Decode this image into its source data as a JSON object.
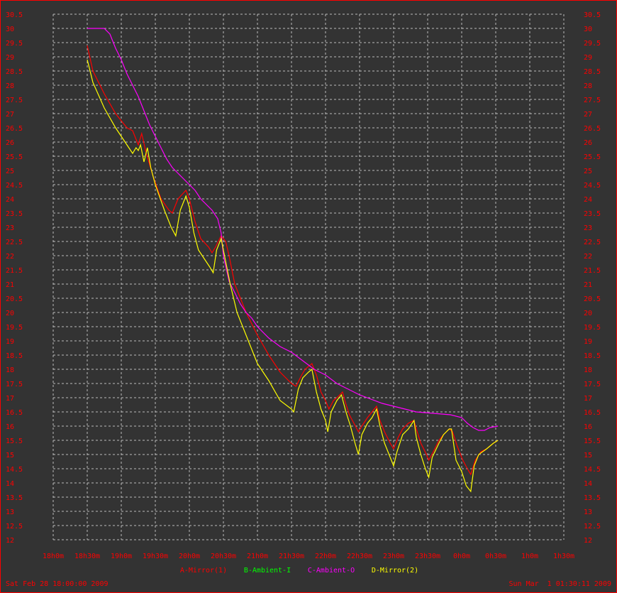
{
  "chart_data": {
    "type": "line",
    "title": "",
    "xlabel": "",
    "ylabel": "",
    "ylim": [
      12,
      30.5
    ],
    "yticks": [
      "12",
      "12.5",
      "13",
      "13.5",
      "14",
      "14.5",
      "15",
      "15.5",
      "16",
      "16.5",
      "17",
      "17.5",
      "18",
      "18.5",
      "19",
      "19.5",
      "20",
      "20.5",
      "21",
      "21.5",
      "22",
      "22.5",
      "23",
      "23.5",
      "24",
      "24.5",
      "25",
      "25.5",
      "26",
      "26.5",
      "27",
      "27.5",
      "28",
      "28.5",
      "29",
      "29.5",
      "30",
      "30.5"
    ],
    "xticks": [
      "18h0m",
      "18h30m",
      "19h0m",
      "19h30m",
      "20h0m",
      "20h30m",
      "21h0m",
      "21h30m",
      "22h0m",
      "22h30m",
      "23h0m",
      "23h30m",
      "0h0m",
      "0h30m",
      "1h0m",
      "1h30m"
    ],
    "x_unit": "minutes since 18h0m",
    "grid": true,
    "legend_position": "bottom",
    "start_label": "Sat Feb 28 18:00:00 2009",
    "end_label": "Sun Mar  1 01:30:11 2009",
    "colors": {
      "background": "#333333",
      "grid": "#bbbbbb",
      "axis_text": "#ff0000",
      "border": "#ff0000"
    },
    "series": [
      {
        "name": "A-Mirror(1)",
        "color": "#ff0000",
        "points": [
          [
            30,
            29.4
          ],
          [
            35,
            28.5
          ],
          [
            45,
            27.7
          ],
          [
            55,
            27.0
          ],
          [
            65,
            26.5
          ],
          [
            70,
            26.4
          ],
          [
            73,
            26.1
          ],
          [
            75,
            25.9
          ],
          [
            78,
            26.3
          ],
          [
            82,
            25.6
          ],
          [
            88,
            24.8
          ],
          [
            95,
            24.0
          ],
          [
            102,
            23.6
          ],
          [
            105,
            23.5
          ],
          [
            110,
            24.0
          ],
          [
            117,
            24.3
          ],
          [
            120,
            24.0
          ],
          [
            125,
            23.2
          ],
          [
            130,
            22.6
          ],
          [
            137,
            22.3
          ],
          [
            140,
            22.1
          ],
          [
            143,
            22.3
          ],
          [
            148,
            22.7
          ],
          [
            152,
            22.5
          ],
          [
            155,
            22.0
          ],
          [
            160,
            21.0
          ],
          [
            170,
            20.0
          ],
          [
            180,
            19.2
          ],
          [
            190,
            18.5
          ],
          [
            200,
            17.9
          ],
          [
            210,
            17.5
          ],
          [
            214,
            17.4
          ],
          [
            219,
            17.8
          ],
          [
            222,
            18.0
          ],
          [
            228,
            18.2
          ],
          [
            232,
            17.8
          ],
          [
            236,
            17.2
          ],
          [
            240,
            16.9
          ],
          [
            243,
            16.6
          ],
          [
            247,
            16.9
          ],
          [
            250,
            17.0
          ],
          [
            255,
            17.2
          ],
          [
            257,
            16.9
          ],
          [
            261,
            16.4
          ],
          [
            265,
            16.1
          ],
          [
            269,
            15.8
          ],
          [
            272,
            16.0
          ],
          [
            277,
            16.3
          ],
          [
            281,
            16.5
          ],
          [
            285,
            16.7
          ],
          [
            288,
            16.2
          ],
          [
            292,
            15.8
          ],
          [
            297,
            15.4
          ],
          [
            300,
            15.2
          ],
          [
            304,
            15.6
          ],
          [
            308,
            15.9
          ],
          [
            313,
            16.1
          ],
          [
            318,
            16.2
          ],
          [
            320,
            15.9
          ],
          [
            324,
            15.4
          ],
          [
            329,
            15.0
          ],
          [
            331,
            14.8
          ],
          [
            335,
            15.1
          ],
          [
            340,
            15.5
          ],
          [
            344,
            15.7
          ],
          [
            349,
            15.9
          ],
          [
            352,
            15.8
          ],
          [
            356,
            15.3
          ],
          [
            361,
            14.8
          ],
          [
            365,
            14.5
          ],
          [
            368,
            14.3
          ],
          [
            372,
            14.8
          ],
          [
            377,
            15.1
          ],
          [
            382,
            15.2
          ],
          [
            388,
            15.4
          ],
          [
            392,
            15.5
          ]
        ]
      },
      {
        "name": "B-Ambient-I",
        "color": "#00ff00",
        "points": []
      },
      {
        "name": "C-Ambient-O",
        "color": "#ff00ff",
        "points": [
          [
            30,
            30.0
          ],
          [
            45,
            30.0
          ],
          [
            50,
            29.8
          ],
          [
            55,
            29.3
          ],
          [
            60,
            28.9
          ],
          [
            65,
            28.4
          ],
          [
            70,
            28.0
          ],
          [
            75,
            27.6
          ],
          [
            80,
            27.1
          ],
          [
            85,
            26.6
          ],
          [
            90,
            26.2
          ],
          [
            95,
            25.8
          ],
          [
            100,
            25.4
          ],
          [
            105,
            25.1
          ],
          [
            110,
            24.9
          ],
          [
            115,
            24.7
          ],
          [
            120,
            24.5
          ],
          [
            125,
            24.3
          ],
          [
            130,
            24.0
          ],
          [
            135,
            23.8
          ],
          [
            140,
            23.6
          ],
          [
            145,
            23.3
          ],
          [
            148,
            22.8
          ],
          [
            150,
            22.0
          ],
          [
            155,
            21.1
          ],
          [
            160,
            20.7
          ],
          [
            165,
            20.3
          ],
          [
            170,
            20.0
          ],
          [
            175,
            19.8
          ],
          [
            180,
            19.5
          ],
          [
            190,
            19.1
          ],
          [
            200,
            18.8
          ],
          [
            210,
            18.6
          ],
          [
            220,
            18.3
          ],
          [
            230,
            18.0
          ],
          [
            240,
            17.8
          ],
          [
            250,
            17.5
          ],
          [
            260,
            17.3
          ],
          [
            270,
            17.1
          ],
          [
            280,
            16.95
          ],
          [
            290,
            16.8
          ],
          [
            300,
            16.7
          ],
          [
            310,
            16.6
          ],
          [
            320,
            16.5
          ],
          [
            335,
            16.45
          ],
          [
            350,
            16.4
          ],
          [
            360,
            16.3
          ],
          [
            365,
            16.1
          ],
          [
            370,
            15.95
          ],
          [
            375,
            15.85
          ],
          [
            380,
            15.85
          ],
          [
            385,
            15.95
          ],
          [
            392,
            16.0
          ]
        ]
      },
      {
        "name": "D-Mirror(2)",
        "color": "#ffff00",
        "points": [
          [
            30,
            28.9
          ],
          [
            35,
            28.1
          ],
          [
            45,
            27.2
          ],
          [
            55,
            26.5
          ],
          [
            65,
            25.9
          ],
          [
            70,
            25.6
          ],
          [
            73,
            25.8
          ],
          [
            75,
            25.7
          ],
          [
            77,
            25.9
          ],
          [
            80,
            25.3
          ],
          [
            83,
            25.8
          ],
          [
            86,
            25.1
          ],
          [
            90,
            24.5
          ],
          [
            98,
            23.6
          ],
          [
            104,
            23.0
          ],
          [
            108,
            22.7
          ],
          [
            112,
            23.6
          ],
          [
            117,
            24.1
          ],
          [
            120,
            23.7
          ],
          [
            124,
            22.8
          ],
          [
            128,
            22.2
          ],
          [
            133,
            21.9
          ],
          [
            138,
            21.6
          ],
          [
            141,
            21.4
          ],
          [
            144,
            22.2
          ],
          [
            148,
            22.6
          ],
          [
            152,
            21.8
          ],
          [
            156,
            21.0
          ],
          [
            162,
            20.0
          ],
          [
            172,
            19.0
          ],
          [
            180,
            18.2
          ],
          [
            190,
            17.6
          ],
          [
            200,
            16.9
          ],
          [
            210,
            16.6
          ],
          [
            212,
            16.5
          ],
          [
            216,
            17.3
          ],
          [
            220,
            17.7
          ],
          [
            225,
            17.9
          ],
          [
            228,
            18.0
          ],
          [
            232,
            17.2
          ],
          [
            236,
            16.6
          ],
          [
            240,
            16.2
          ],
          [
            242,
            15.8
          ],
          [
            245,
            16.5
          ],
          [
            250,
            16.9
          ],
          [
            254,
            17.1
          ],
          [
            258,
            16.5
          ],
          [
            262,
            16.0
          ],
          [
            266,
            15.4
          ],
          [
            269,
            15.0
          ],
          [
            272,
            15.7
          ],
          [
            277,
            16.1
          ],
          [
            281,
            16.3
          ],
          [
            285,
            16.6
          ],
          [
            288,
            16.0
          ],
          [
            292,
            15.4
          ],
          [
            297,
            14.9
          ],
          [
            300,
            14.6
          ],
          [
            303,
            15.1
          ],
          [
            308,
            15.7
          ],
          [
            313,
            15.9
          ],
          [
            318,
            16.2
          ],
          [
            320,
            15.6
          ],
          [
            324,
            15.0
          ],
          [
            328,
            14.5
          ],
          [
            331,
            14.2
          ],
          [
            334,
            14.9
          ],
          [
            340,
            15.4
          ],
          [
            344,
            15.7
          ],
          [
            349,
            15.9
          ],
          [
            351,
            15.9
          ],
          [
            355,
            14.8
          ],
          [
            360,
            14.4
          ],
          [
            364,
            13.9
          ],
          [
            368,
            13.7
          ],
          [
            371,
            14.6
          ],
          [
            375,
            15.0
          ],
          [
            382,
            15.2
          ],
          [
            388,
            15.4
          ],
          [
            392,
            15.5
          ]
        ]
      }
    ]
  }
}
